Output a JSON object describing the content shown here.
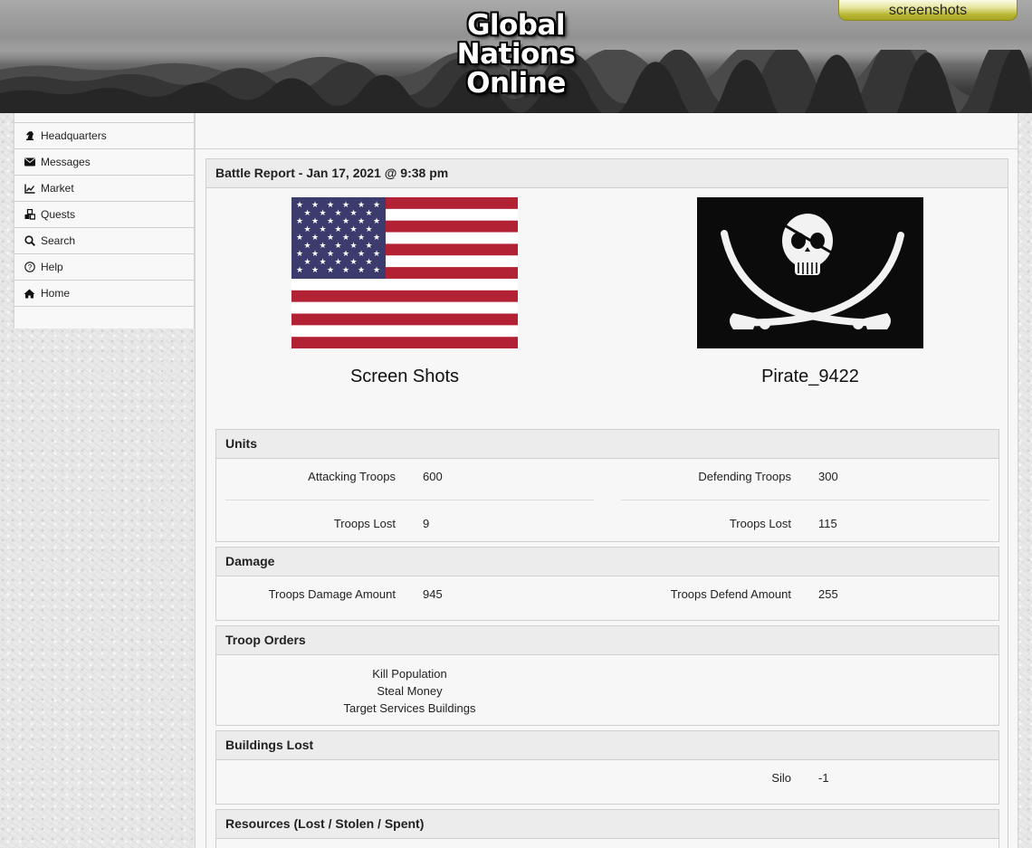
{
  "header": {
    "logo_line1": "Global",
    "logo_line2": "Nations",
    "logo_line3": "Online",
    "user_tab": "screenshots"
  },
  "sidebar": {
    "items": [
      {
        "label": "Headquarters",
        "icon": "chess-knight-icon"
      },
      {
        "label": "Messages",
        "icon": "envelope-icon"
      },
      {
        "label": "Market",
        "icon": "line-chart-icon"
      },
      {
        "label": "Quests",
        "icon": "cubes-icon"
      },
      {
        "label": "Search",
        "icon": "search-icon"
      },
      {
        "label": "Help",
        "icon": "question-circle-icon"
      },
      {
        "label": "Home",
        "icon": "home-icon"
      }
    ]
  },
  "report": {
    "title": "Battle Report - Jan 17, 2021 @ 9:38 pm",
    "attacker": {
      "name": "Screen Shots",
      "flag": "us-flag"
    },
    "defender": {
      "name": "Pirate_9422",
      "flag": "pirate-flag"
    },
    "units": {
      "title": "Units",
      "attacking_troops_label": "Attacking Troops",
      "attacking_troops_value": "600",
      "defending_troops_label": "Defending Troops",
      "defending_troops_value": "300",
      "attacker_lost_label": "Troops Lost",
      "attacker_lost_value": "9",
      "defender_lost_label": "Troops Lost",
      "defender_lost_value": "115"
    },
    "damage": {
      "title": "Damage",
      "damage_label": "Troops Damage Amount",
      "damage_value": "945",
      "defend_label": "Troops Defend Amount",
      "defend_value": "255"
    },
    "orders": {
      "title": "Troop Orders",
      "items": [
        "Kill Population",
        "Steal Money",
        "Target Services Buildings"
      ]
    },
    "buildings": {
      "title": "Buildings Lost",
      "building_label": "Silo",
      "building_value": "-1"
    },
    "resources": {
      "title": "Resources (Lost / Stolen / Spent)"
    }
  },
  "colors": {
    "tab_accent": "#b7b530",
    "panel_bg": "#f7f7f7",
    "section_head_bg": "#ececec",
    "border": "#cfcfcf"
  }
}
